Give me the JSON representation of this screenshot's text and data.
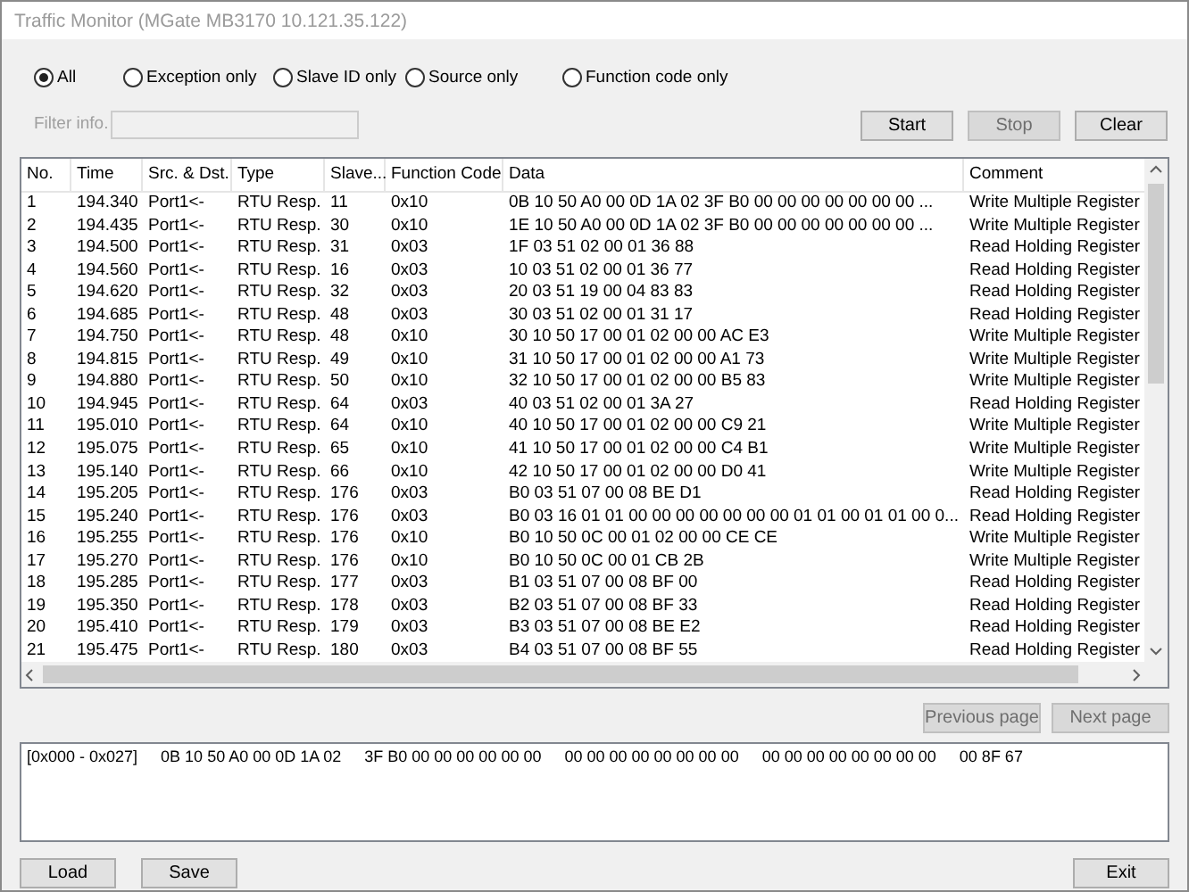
{
  "window": {
    "title": "Traffic Monitor (MGate MB3170 10.121.35.122)"
  },
  "filters": [
    {
      "label": "All",
      "selected": true
    },
    {
      "label": "Exception only",
      "selected": false
    },
    {
      "label": "Slave ID only",
      "selected": false
    },
    {
      "label": "Source only",
      "selected": false
    },
    {
      "label": "Function code only",
      "selected": false
    }
  ],
  "filter_info": {
    "label": "Filter info.",
    "disabled": true
  },
  "capture_buttons": [
    {
      "label": "Start",
      "disabled": false
    },
    {
      "label": "Stop",
      "disabled": true
    },
    {
      "label": "Clear",
      "disabled": false
    }
  ],
  "table": {
    "columns": [
      "No.",
      "Time",
      "Src. & Dst.",
      "Type",
      "Slave...",
      "Function Code",
      "Data",
      "Comment"
    ],
    "rows": [
      [
        "1",
        "194.340",
        "Port1<-",
        "RTU Resp.",
        "11",
        "0x10",
        "0B 10 50 A0 00 0D 1A 02 3F B0 00 00 00 00 00 00 00 ...",
        "Write Multiple Register"
      ],
      [
        "2",
        "194.435",
        "Port1<-",
        "RTU Resp.",
        "30",
        "0x10",
        "1E 10 50 A0 00 0D 1A 02 3F B0 00 00 00 00 00 00 00 ...",
        "Write Multiple Register"
      ],
      [
        "3",
        "194.500",
        "Port1<-",
        "RTU Resp.",
        "31",
        "0x03",
        "1F 03 51 02 00 01 36 88",
        "Read Holding Register"
      ],
      [
        "4",
        "194.560",
        "Port1<-",
        "RTU Resp.",
        "16",
        "0x03",
        "10 03 51 02 00 01 36 77",
        "Read Holding Register"
      ],
      [
        "5",
        "194.620",
        "Port1<-",
        "RTU Resp.",
        "32",
        "0x03",
        "20 03 51 19 00 04 83 83",
        "Read Holding Register"
      ],
      [
        "6",
        "194.685",
        "Port1<-",
        "RTU Resp.",
        "48",
        "0x03",
        "30 03 51 02 00 01 31 17",
        "Read Holding Register"
      ],
      [
        "7",
        "194.750",
        "Port1<-",
        "RTU Resp.",
        "48",
        "0x10",
        "30 10 50 17 00 01 02 00 00 AC E3",
        "Write Multiple Register"
      ],
      [
        "8",
        "194.815",
        "Port1<-",
        "RTU Resp.",
        "49",
        "0x10",
        "31 10 50 17 00 01 02 00 00 A1 73",
        "Write Multiple Register"
      ],
      [
        "9",
        "194.880",
        "Port1<-",
        "RTU Resp.",
        "50",
        "0x10",
        "32 10 50 17 00 01 02 00 00 B5 83",
        "Write Multiple Register"
      ],
      [
        "10",
        "194.945",
        "Port1<-",
        "RTU Resp.",
        "64",
        "0x03",
        "40 03 51 02 00 01 3A 27",
        "Read Holding Register"
      ],
      [
        "11",
        "195.010",
        "Port1<-",
        "RTU Resp.",
        "64",
        "0x10",
        "40 10 50 17 00 01 02 00 00 C9 21",
        "Write Multiple Register"
      ],
      [
        "12",
        "195.075",
        "Port1<-",
        "RTU Resp.",
        "65",
        "0x10",
        "41 10 50 17 00 01 02 00 00 C4 B1",
        "Write Multiple Register"
      ],
      [
        "13",
        "195.140",
        "Port1<-",
        "RTU Resp.",
        "66",
        "0x10",
        "42 10 50 17 00 01 02 00 00 D0 41",
        "Write Multiple Register"
      ],
      [
        "14",
        "195.205",
        "Port1<-",
        "RTU Resp.",
        "176",
        "0x03",
        "B0 03 51 07 00 08 BE D1",
        "Read Holding Register"
      ],
      [
        "15",
        "195.240",
        "Port1<-",
        "RTU Resp.",
        "176",
        "0x03",
        "B0 03 16 01 01 00 00 00 00 00 00 00 01 01 00 01 01 00 0...",
        "Read Holding Register"
      ],
      [
        "16",
        "195.255",
        "Port1<-",
        "RTU Resp.",
        "176",
        "0x10",
        "B0 10 50 0C 00 01 02 00 00 CE CE",
        "Write Multiple Register"
      ],
      [
        "17",
        "195.270",
        "Port1<-",
        "RTU Resp.",
        "176",
        "0x10",
        "B0 10 50 0C 00 01 CB 2B",
        "Write Multiple Register"
      ],
      [
        "18",
        "195.285",
        "Port1<-",
        "RTU Resp.",
        "177",
        "0x03",
        "B1 03 51 07 00 08 BF 00",
        "Read Holding Register"
      ],
      [
        "19",
        "195.350",
        "Port1<-",
        "RTU Resp.",
        "178",
        "0x03",
        "B2 03 51 07 00 08 BF 33",
        "Read Holding Register"
      ],
      [
        "20",
        "195.410",
        "Port1<-",
        "RTU Resp.",
        "179",
        "0x03",
        "B3 03 51 07 00 08 BE E2",
        "Read Holding Register"
      ],
      [
        "21",
        "195.475",
        "Port1<-",
        "RTU Resp.",
        "180",
        "0x03",
        "B4 03 51 07 00 08 BF 55",
        "Read Holding Register"
      ]
    ]
  },
  "pager_buttons": [
    {
      "label": "Previous page",
      "disabled": true
    },
    {
      "label": "Next page",
      "disabled": true
    }
  ],
  "hex_view": {
    "segments": [
      "[0x000 - 0x027]",
      "0B 10 50 A0 00 0D 1A 02",
      "3F B0 00 00 00 00 00 00",
      "00 00 00 00 00 00 00 00",
      "00 00 00 00 00 00 00 00",
      "00 8F 67"
    ]
  },
  "file_buttons": [
    {
      "label": "Load"
    },
    {
      "label": "Save"
    }
  ],
  "exit_button": {
    "label": "Exit"
  }
}
